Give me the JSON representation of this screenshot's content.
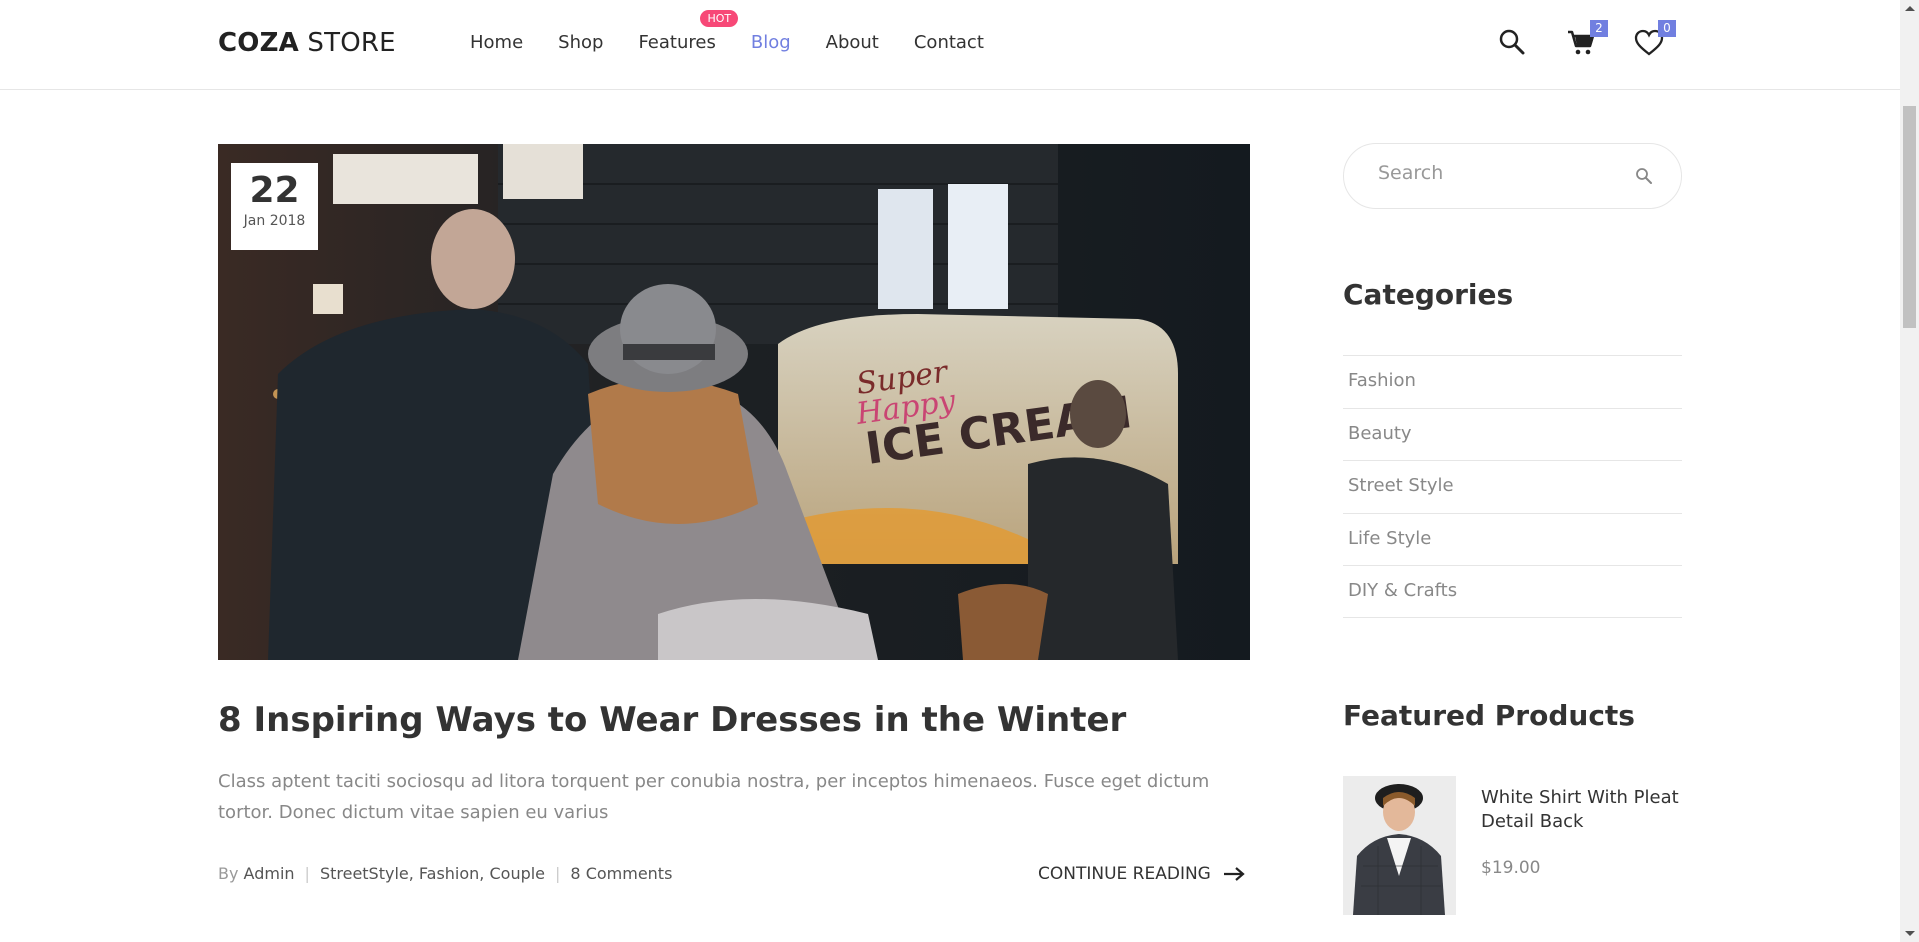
{
  "header": {
    "logo_bold": "COZA",
    "logo_light": " STORE",
    "nav": [
      {
        "label": "Home"
      },
      {
        "label": "Shop"
      },
      {
        "label": "Features",
        "badge": "HOT"
      },
      {
        "label": "Blog",
        "active": true
      },
      {
        "label": "About"
      },
      {
        "label": "Contact"
      }
    ],
    "cart_count": "2",
    "wishlist_count": "0"
  },
  "post": {
    "date_day": "22",
    "date_month": "Jan 2018",
    "title": "8 Inspiring Ways to Wear Dresses in the Winter",
    "excerpt": "Class aptent taciti sociosqu ad litora torquent per conubia nostra, per inceptos himenaeos. Fusce eget dictum tortor. Donec dictum vitae sapien eu varius",
    "by_label": "By",
    "author": "Admin",
    "tags": "StreetStyle, Fashion, Couple",
    "comments": "8 Comments",
    "continue_label": "CONTINUE READING"
  },
  "sidebar": {
    "search_placeholder": "Search",
    "categories_heading": "Categories",
    "categories": [
      "Fashion",
      "Beauty",
      "Street Style",
      "Life Style",
      "DIY & Crafts"
    ],
    "featured_heading": "Featured Products",
    "product_name": "White Shirt With Pleat Detail Back",
    "product_price": "$19.00"
  },
  "colors": {
    "accent": "#717fe0",
    "hot": "#f74877"
  }
}
